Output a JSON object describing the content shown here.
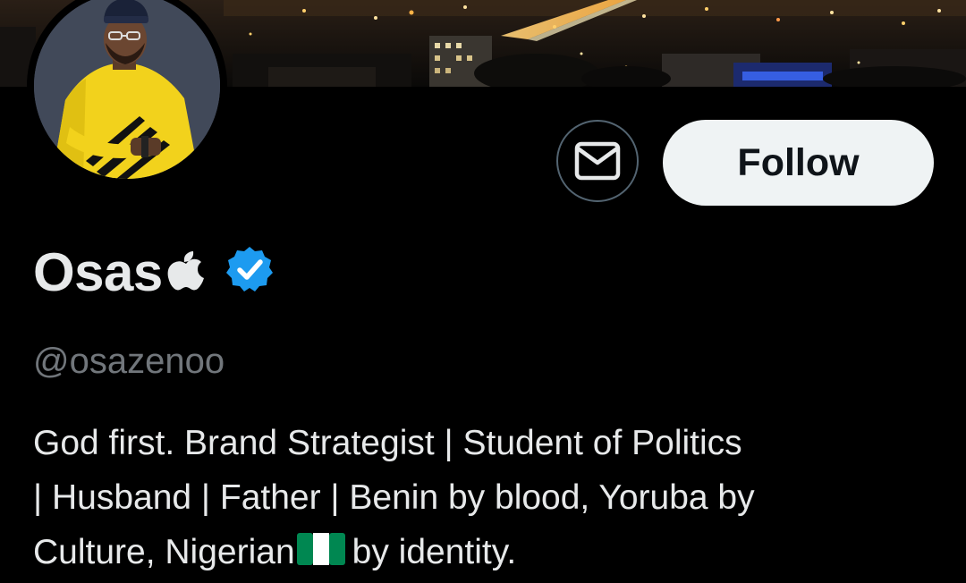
{
  "profile": {
    "display_name": "Osas",
    "name_badge_icon": "apple-logo-icon",
    "verified_icon": "verified-badge-icon",
    "handle": "@osazenoo",
    "bio_lines": [
      "God first. Brand Strategist | Student of Politics",
      "| Husband | Father | Benin by blood, Yoruba by",
      "Culture, Nigerian",
      "by identity."
    ],
    "bio_flag_icon": "nigeria-flag-icon"
  },
  "actions": {
    "message_icon": "envelope-icon",
    "follow_label": "Follow"
  },
  "colors": {
    "background": "#000000",
    "text_primary": "#e7e9ea",
    "text_secondary": "#71767b",
    "verified_blue": "#1d9bf0",
    "follow_bg": "#eff3f4",
    "follow_text": "#0f1419",
    "outline_border": "#536471"
  }
}
